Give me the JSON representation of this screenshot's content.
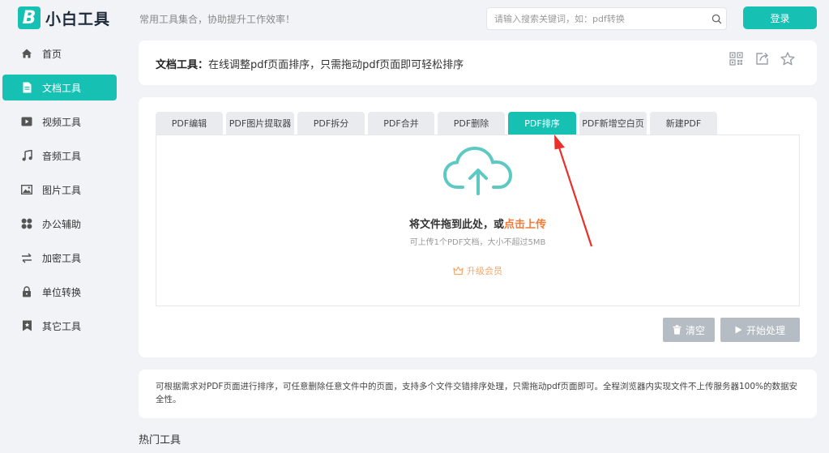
{
  "header": {
    "logo_text": "小白工具",
    "slogan": "常用工具集合，协助提升工作效率！",
    "search_placeholder": "请输入搜索关键词，如：pdf转换",
    "login_label": "登录"
  },
  "sidebar": {
    "items": [
      {
        "label": "首页",
        "icon": "home-icon"
      },
      {
        "label": "文档工具",
        "icon": "document-icon",
        "active": true
      },
      {
        "label": "视频工具",
        "icon": "video-icon"
      },
      {
        "label": "音频工具",
        "icon": "music-icon"
      },
      {
        "label": "图片工具",
        "icon": "image-icon"
      },
      {
        "label": "办公辅助",
        "icon": "apps-icon"
      },
      {
        "label": "加密工具",
        "icon": "encrypt-icon"
      },
      {
        "label": "单位转换",
        "icon": "lock-icon"
      },
      {
        "label": "其它工具",
        "icon": "bookmark-icon"
      }
    ]
  },
  "title_card": {
    "category": "文档工具：",
    "description": "在线调整pdf页面排序，只需拖动pdf页面即可轻松排序"
  },
  "tabs": [
    {
      "label": "PDF编辑"
    },
    {
      "label": "PDF图片提取器"
    },
    {
      "label": "PDF拆分"
    },
    {
      "label": "PDF合并"
    },
    {
      "label": "PDF删除"
    },
    {
      "label": "PDF排序",
      "active": true
    },
    {
      "label": "PDF新增空白页"
    },
    {
      "label": "新建PDF"
    }
  ],
  "upload": {
    "title_prefix": "将文件拖到此处，或",
    "title_link": "点击上传",
    "hint": "可上传1个PDF文档，大小不超过5MB",
    "upgrade_label": "升级会员"
  },
  "actions": {
    "clear_label": "清空",
    "start_label": "开始处理"
  },
  "description": "可根据需求对PDF页面进行排序，可任意删除任意文件中的页面，支持多个文件交错排序处理，只需拖动pdf页面即可。全程浏览器内实现文件不上传服务器100%的数据安全性。",
  "hot_tools_title": "热门工具",
  "colors": {
    "accent": "#16c1b4",
    "highlight": "#f27a35",
    "annotation_arrow": "#e8312a"
  }
}
